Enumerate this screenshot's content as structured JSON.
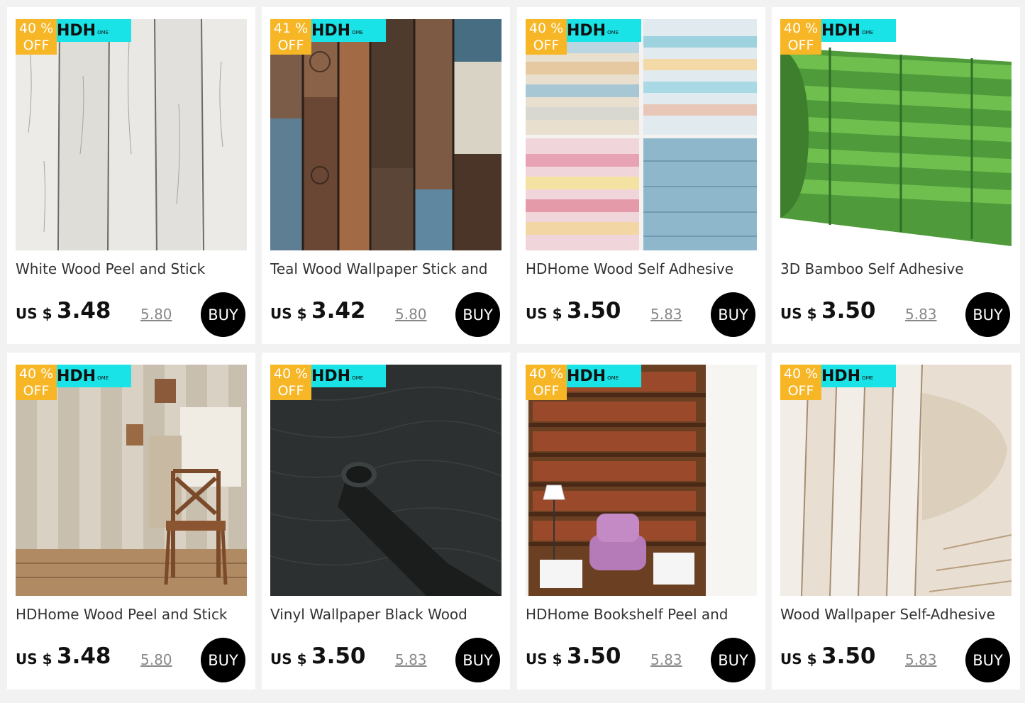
{
  "products": [
    {
      "title": "White Wood Peel and Stick",
      "currency": "US $",
      "price": "3.48",
      "old_price": "5.80",
      "discount_pct": "40 %",
      "discount_off": "OFF",
      "brand": "HDH",
      "brand_small": "OME",
      "buy_label": "BUY",
      "image": "white-wood-planks"
    },
    {
      "title": "Teal Wood Wallpaper Stick and",
      "currency": "US $",
      "price": "3.42",
      "old_price": "5.80",
      "discount_pct": "41 %",
      "discount_off": "OFF",
      "brand": "HDH",
      "brand_small": "OME",
      "buy_label": "BUY",
      "image": "teal-brown-wood-planks"
    },
    {
      "title": "HDHome Wood Self Adhesive",
      "currency": "US $",
      "price": "3.50",
      "old_price": "5.83",
      "discount_pct": "40 %",
      "discount_off": "OFF",
      "brand": "HDH",
      "brand_small": "OME",
      "buy_label": "BUY",
      "image": "pastel-wallpaper-rolls"
    },
    {
      "title": "3D Bamboo Self Adhesive",
      "currency": "US $",
      "price": "3.50",
      "old_price": "5.83",
      "discount_pct": "40 %",
      "discount_off": "OFF",
      "brand": "HDH",
      "brand_small": "OME",
      "buy_label": "BUY",
      "image": "green-bamboo-roll"
    },
    {
      "title": "HDHome Wood Peel and Stick",
      "currency": "US $",
      "price": "3.48",
      "old_price": "5.80",
      "discount_pct": "40 %",
      "discount_off": "OFF",
      "brand": "HDH",
      "brand_small": "OME",
      "buy_label": "BUY",
      "image": "wood-wall-with-chair"
    },
    {
      "title": "Vinyl Wallpaper Black Wood",
      "currency": "US $",
      "price": "3.50",
      "old_price": "5.83",
      "discount_pct": "40 %",
      "discount_off": "OFF",
      "brand": "HDH",
      "brand_small": "OME",
      "buy_label": "BUY",
      "image": "black-wood-roll"
    },
    {
      "title": "HDHome Bookshelf Peel and",
      "currency": "US $",
      "price": "3.50",
      "old_price": "5.83",
      "discount_pct": "40 %",
      "discount_off": "OFF",
      "brand": "HDH",
      "brand_small": "OME",
      "buy_label": "BUY",
      "image": "bookshelf-room"
    },
    {
      "title": "Wood Wallpaper Self-Adhesive",
      "currency": "US $",
      "price": "3.50",
      "old_price": "5.83",
      "discount_pct": "40 %",
      "discount_off": "OFF",
      "brand": "HDH",
      "brand_small": "OME",
      "buy_label": "BUY",
      "image": "whitewashed-wood-roll"
    }
  ],
  "colors": {
    "discount_badge": "#f6b625",
    "brand_strip": "#19e3e6",
    "buy_button": "#000000",
    "page_bg": "#f2f2f2"
  }
}
